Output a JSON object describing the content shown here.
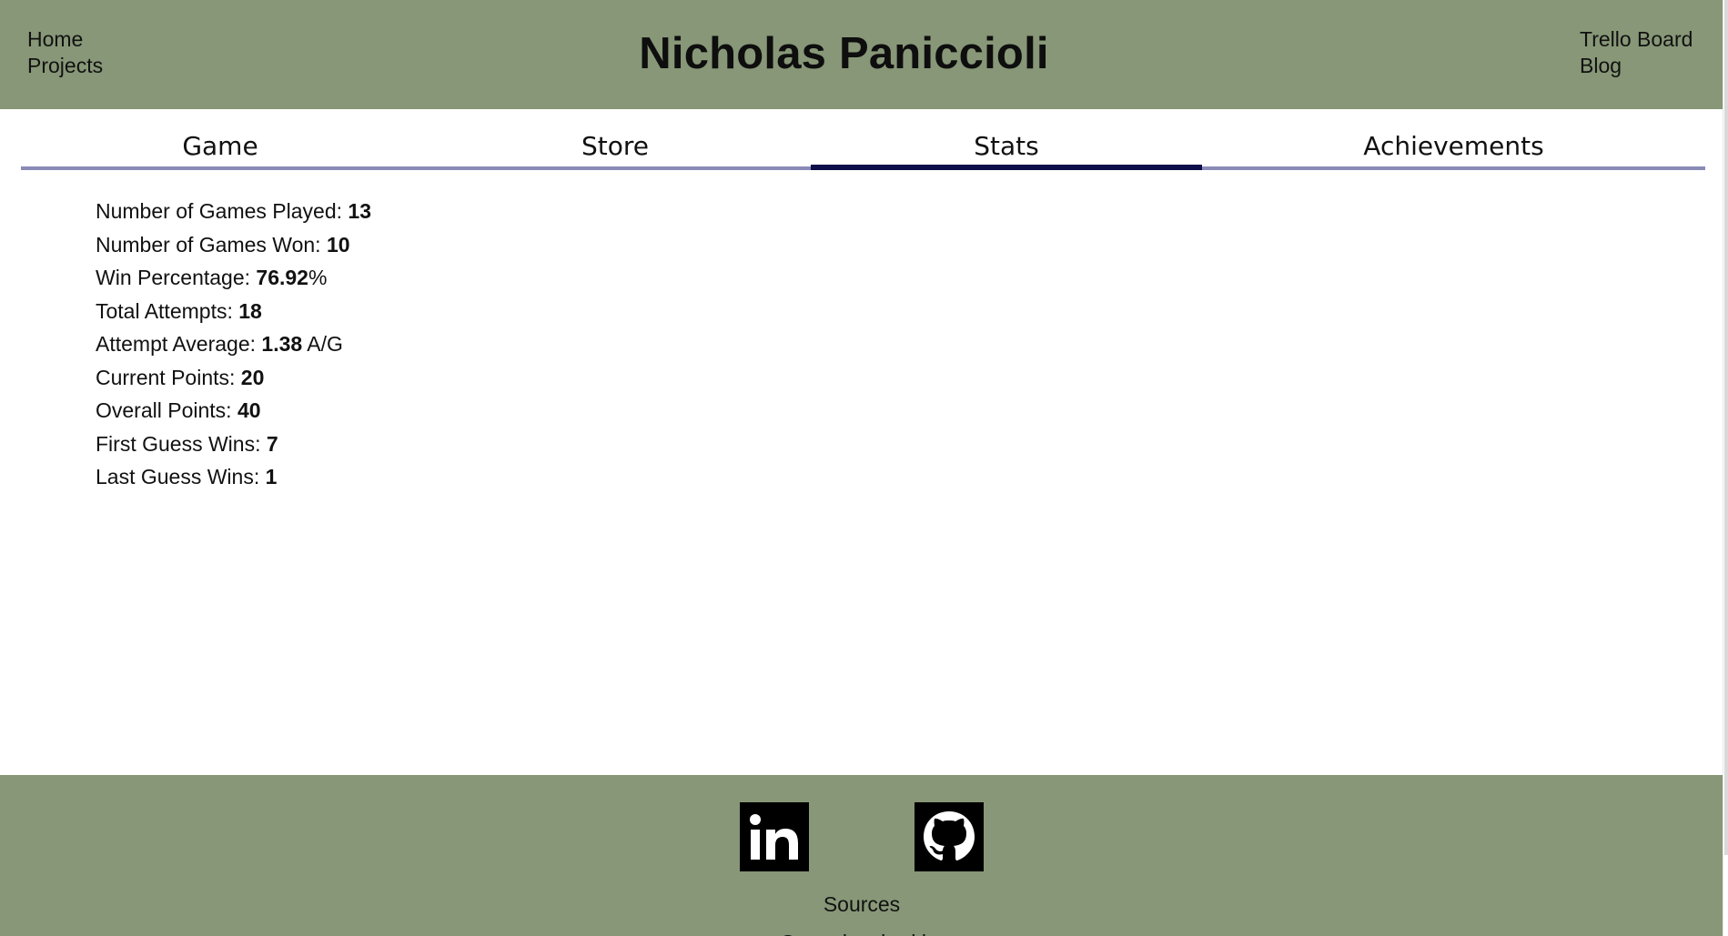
{
  "header": {
    "title": "Nicholas Paniccioli",
    "nav_left": [
      "Home",
      "Projects"
    ],
    "nav_right": [
      "Trello Board",
      "Blog"
    ],
    "background": "#879777"
  },
  "tabs": {
    "items": [
      "Game",
      "Store",
      "Stats",
      "Achievements"
    ],
    "active": "Stats",
    "underline_color": "#8a8ab8",
    "active_color": "#0d0d4a"
  },
  "stats": {
    "games_played_label": "Number of Games Played: ",
    "games_played": "13",
    "games_won_label": "Number of Games Won: ",
    "games_won": "10",
    "win_pct_label": "Win Percentage: ",
    "win_pct": "76.92",
    "win_pct_unit": "%",
    "total_attempts_label": "Total Attempts: ",
    "total_attempts": "18",
    "attempt_avg_label": "Attempt Average: ",
    "attempt_avg": "1.38",
    "attempt_avg_unit": " A/G",
    "current_points_label": "Current Points: ",
    "current_points": "20",
    "overall_points_label": "Overall Points: ",
    "overall_points": "40",
    "first_guess_label": "First Guess Wins: ",
    "first_guess": "7",
    "last_guess_label": "Last Guess Wins: ",
    "last_guess": "1"
  },
  "footer": {
    "icons": [
      "linkedin-icon",
      "github-icon"
    ],
    "sources_label": "Sources",
    "cut_line": "Game inspired by"
  }
}
